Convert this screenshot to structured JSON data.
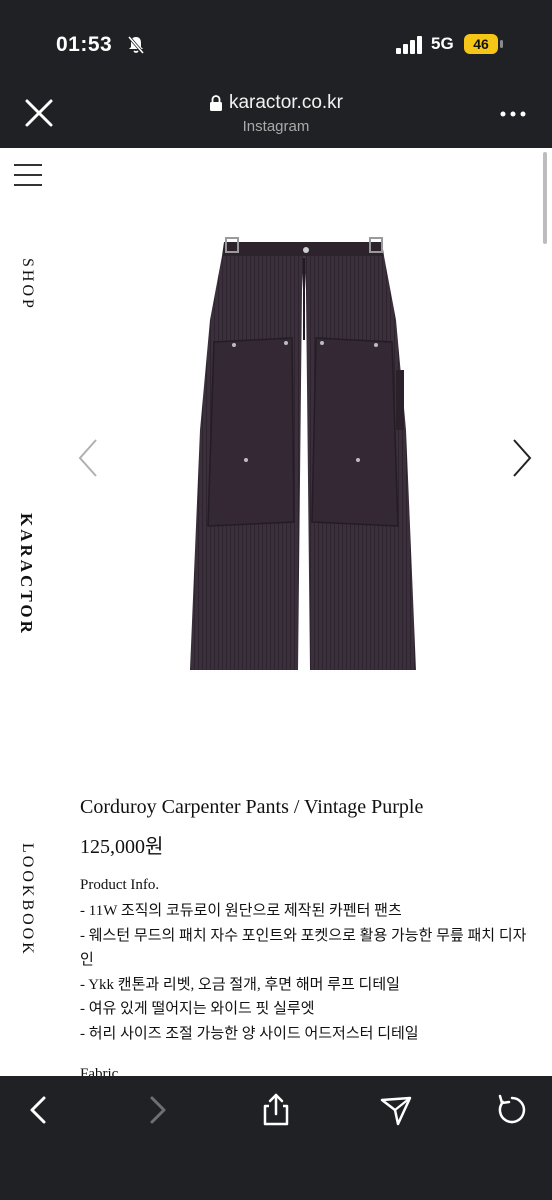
{
  "status_bar": {
    "time": "01:53",
    "network": "5G",
    "battery": "46"
  },
  "browser": {
    "url": "karactor.co.kr",
    "source": "Instagram"
  },
  "nav": {
    "shop": "SHOP",
    "brand": "KARACTOR",
    "lookbook": "LOOKBOOK"
  },
  "product": {
    "title": "Corduroy Carpenter Pants / Vintage Purple",
    "price": "125,000원",
    "info_heading": "Product Info.",
    "info_items": [
      "- 11W 조직의 코듀로이 원단으로 제작된 카펜터 팬츠",
      "- 웨스턴 무드의 패치 자수 포인트와 포켓으로 활용 가능한 무릎 패치 디자인",
      "- Ykk 캔톤과 리벳, 오금 절개, 후면 해머 루프 디테일",
      "- 여유 있게 떨어지는 와이드 핏 실루엣",
      "- 허리 사이즈 조절 가능한 양 사이드 어드저스터 디테일"
    ],
    "fabric_heading": "Fabric"
  },
  "colors": {
    "chrome": "#1f2124",
    "battery": "#f5c518",
    "pants": "#3a2f3b"
  }
}
